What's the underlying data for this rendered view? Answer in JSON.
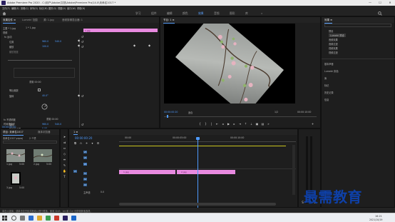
{
  "window": {
    "title": "Adobe Premiere Pro 2020 - C:\\用户\\Adobe\\文档\\Adobe\\Premiere Pro\\14.0\\未命名1017 *",
    "min_label": "—",
    "max_label": "☐",
    "close_label": "✕"
  },
  "menu": [
    "文件(F)",
    "编辑(E)",
    "剪辑(C)",
    "序列(S)",
    "标记(M)",
    "图形(G)",
    "视图(V)",
    "窗口(W)",
    "帮助(H)"
  ],
  "workspaces": [
    "学习",
    "组件",
    "编辑",
    "颜色",
    "效果",
    "音频",
    "图形",
    "库"
  ],
  "active_workspace": "效果",
  "effect_controls": {
    "tabs": [
      "效果控件 ≡",
      "Lumetri 范围",
      "源: 1.jpg",
      "音频剪辑混合器: 1"
    ],
    "master": "主要 * 1.jpg",
    "sequence": "1 * 1.jpg",
    "clip_label": "1.jpg",
    "video_label": "视频",
    "motion": "fx 运动",
    "position_label": "位置",
    "position_x": "960.0",
    "position_y": "540.0",
    "scale_label": "缩放",
    "scale_value": "100.0",
    "width_scale_label": "缩放宽度",
    "uniform_label": "等比缩放",
    "rotation_label": "旋转",
    "rotation_value": "40.0°",
    "anchor_label": "锚点",
    "anchor_x": "960.0",
    "anchor_y": "540.0",
    "flicker_label": "防闪烁滤镜",
    "flicker_value": "0.00",
    "opacity": "fx 不透明度",
    "time_remap": "时间重映射",
    "reset_label": "重置",
    "timecode": "00:00:00:00",
    "sub_reset_a": "重置 00:00",
    "sub_reset_b": "重置 00:00"
  },
  "program": {
    "tab": "节目: 1 ≡",
    "timecode_left": "00:00:00:20",
    "fit_label": "适合",
    "fraction": "1/2",
    "timecode_right": "00:00:10:00"
  },
  "project": {
    "tabs": [
      "项目: 未命名1017",
      "媒体浏览器"
    ],
    "filename": "未命名1017.prproj",
    "count": "2 个项",
    "items": [
      {
        "label": "1.jpg",
        "duration": "5:00"
      },
      {
        "label": "2.jpg",
        "duration": "5:00"
      },
      {
        "label": "3.jpg",
        "duration": "5:00"
      }
    ]
  },
  "effects_panel": {
    "header": "效果 ≡",
    "items": [
      "预设",
      "Lumetri 预设",
      "音频效果",
      "音频过渡",
      "视频效果",
      "视频过渡"
    ],
    "lower_items": [
      "基本声音",
      "Lumetri 颜色",
      "库",
      "标记",
      "历史记录",
      "信息"
    ]
  },
  "timeline": {
    "tab": "1 ≡",
    "timecode": "00:00:00:20",
    "ruler": [
      "00:00",
      "00:00:05:00",
      "00:00:10:00"
    ],
    "video_tracks": [
      "V3",
      "V2",
      "V1"
    ],
    "audio_tracks": [
      "A1",
      "A2",
      "A3"
    ],
    "master_label": "主声道",
    "master_value": "0.0",
    "clips": [
      {
        "label": "1.jpg"
      },
      {
        "label": "2.jpg"
      }
    ]
  },
  "status": {
    "text": "单击以选择，或单击空白处并拖动以进行框选。使用 Shift、Alt 和 Ctrl 可获得其他选项。"
  },
  "taskbar": {
    "time": "16:21",
    "date": "2021/10/19"
  },
  "watermark": "最需教育",
  "colors": {
    "accent": "#4e9bff",
    "clip": "#e88ae0",
    "playhead": "#4e9bff"
  }
}
